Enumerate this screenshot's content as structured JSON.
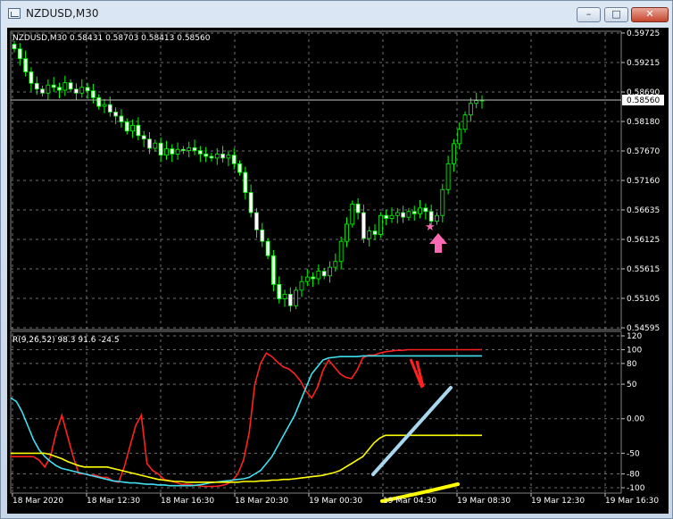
{
  "window": {
    "title": "NZDUSD,M30",
    "buttons": {
      "minimize": "–",
      "maximize": "□",
      "close": "✕"
    }
  },
  "price_panel": {
    "header": "NZDUSD,M30  0.58431 0.58703 0.58413 0.58560",
    "current_price": "0.58560"
  },
  "indicator_panel": {
    "header": "R(9,26,52) 98.3 91.6 -24.5"
  },
  "chart_data": [
    {
      "type": "candlestick",
      "symbol": "NZDUSD",
      "timeframe": "M30",
      "ohlc_header": {
        "open": 0.58431,
        "high": 0.58703,
        "low": 0.58413,
        "close": 0.5856
      },
      "y_ticks": [
        "0.59725",
        "0.59215",
        "0.58690",
        "0.58180",
        "0.57670",
        "0.57160",
        "0.56635",
        "0.56125",
        "0.55615",
        "0.55105",
        "0.54595"
      ],
      "ylim": [
        0.54595,
        0.59725
      ],
      "x_ticks": [
        "18 Mar 2020",
        "18 Mar 12:30",
        "18 Mar 16:30",
        "18 Mar 20:30",
        "19 Mar 00:30",
        "19 Mar 04:30",
        "19 Mar 08:30",
        "19 Mar 12:30",
        "19 Mar 16:30"
      ],
      "last_price": 0.5856,
      "grid": true,
      "colors": {
        "bull": "#000000",
        "bear": "#ffffff",
        "wick": "#00ff00",
        "border": "#00ff00"
      },
      "closes": [
        0.5945,
        0.5928,
        0.5905,
        0.5885,
        0.5875,
        0.5868,
        0.5882,
        0.5878,
        0.5873,
        0.5886,
        0.5875,
        0.5868,
        0.5878,
        0.5872,
        0.586,
        0.5845,
        0.5848,
        0.5835,
        0.5828,
        0.5818,
        0.5802,
        0.5812,
        0.5794,
        0.5788,
        0.5772,
        0.5781,
        0.576,
        0.5771,
        0.5762,
        0.577,
        0.5768,
        0.5773,
        0.5768,
        0.5762,
        0.5758,
        0.5755,
        0.5762,
        0.5755,
        0.576,
        0.5745,
        0.573,
        0.5695,
        0.566,
        0.563,
        0.561,
        0.5585,
        0.5535,
        0.551,
        0.5518,
        0.5498,
        0.5525,
        0.554,
        0.5548,
        0.5545,
        0.5558,
        0.555,
        0.5565,
        0.5575,
        0.561,
        0.564,
        0.5675,
        0.566,
        0.5615,
        0.5628,
        0.5622,
        0.5655,
        0.565,
        0.5655,
        0.566,
        0.5652,
        0.5662,
        0.5658,
        0.5668,
        0.5662,
        0.5645,
        0.5655,
        0.57,
        0.5745,
        0.578,
        0.5805,
        0.583,
        0.585,
        0.5855,
        0.5856
      ]
    },
    {
      "type": "line",
      "name": "R(9,26,52)",
      "values_header": [
        98.3,
        91.6,
        -24.5
      ],
      "y_ticks": [
        "120",
        "100",
        "80",
        "50",
        "0.00",
        "-50",
        "-80",
        "-100"
      ],
      "ylim": [
        -100,
        120
      ],
      "grid": true,
      "series": [
        {
          "color": "#ff2020",
          "values": [
            -55,
            -55,
            -55,
            -55,
            -55,
            -60,
            -70,
            -55,
            -20,
            5,
            -25,
            -55,
            -80,
            -80,
            -82,
            -82,
            -85,
            -85,
            -90,
            -92,
            -70,
            -40,
            -10,
            5,
            -65,
            -75,
            -80,
            -88,
            -90,
            -92,
            -95,
            -95,
            -96,
            -97,
            -98,
            -98,
            -98,
            -97,
            -95,
            -90,
            -80,
            -60,
            -20,
            50,
            80,
            95,
            90,
            82,
            75,
            72,
            65,
            55,
            40,
            30,
            45,
            70,
            85,
            75,
            65,
            60,
            58,
            70,
            88,
            92,
            92,
            95,
            97,
            98,
            99,
            99,
            100,
            100,
            100,
            100,
            100,
            100,
            100,
            100,
            100,
            100,
            100,
            100,
            100,
            100
          ]
        },
        {
          "color": "#40e0f0",
          "values": [
            30,
            25,
            10,
            -10,
            -30,
            -45,
            -55,
            -62,
            -68,
            -72,
            -74,
            -76,
            -78,
            -80,
            -82,
            -84,
            -86,
            -88,
            -90,
            -91,
            -92,
            -93,
            -93,
            -94,
            -95,
            -95,
            -96,
            -96,
            -97,
            -97,
            -97,
            -97,
            -97,
            -96,
            -95,
            -93,
            -92,
            -91,
            -90,
            -89,
            -88,
            -87,
            -85,
            -80,
            -75,
            -65,
            -55,
            -40,
            -25,
            -10,
            5,
            25,
            45,
            65,
            75,
            85,
            88,
            89,
            90,
            90,
            90,
            90,
            91,
            91,
            91,
            91,
            91,
            91,
            91,
            91,
            91,
            91,
            91,
            91,
            91,
            91,
            91,
            91,
            91,
            91,
            91,
            91,
            91,
            91
          ]
        },
        {
          "color": "#ffff00",
          "values": [
            -50,
            -50,
            -50,
            -50,
            -50,
            -50,
            -50,
            -52,
            -55,
            -58,
            -62,
            -65,
            -68,
            -70,
            -70,
            -70,
            -70,
            -70,
            -72,
            -74,
            -76,
            -78,
            -80,
            -82,
            -84,
            -86,
            -88,
            -89,
            -90,
            -91,
            -91,
            -92,
            -92,
            -92,
            -92,
            -92,
            -92,
            -92,
            -92,
            -92,
            -92,
            -91,
            -91,
            -91,
            -90,
            -90,
            -89,
            -89,
            -88,
            -88,
            -87,
            -86,
            -85,
            -84,
            -83,
            -82,
            -80,
            -78,
            -75,
            -70,
            -65,
            -60,
            -55,
            -45,
            -35,
            -28,
            -24,
            -24,
            -24,
            -24,
            -24,
            -24,
            -24,
            -24,
            -24,
            -24,
            -24,
            -24,
            -24,
            -24,
            -24,
            -24,
            -24,
            -24
          ]
        }
      ]
    }
  ],
  "annotations": {
    "marker_star": "★",
    "arrow_color": "#ff69b4"
  }
}
